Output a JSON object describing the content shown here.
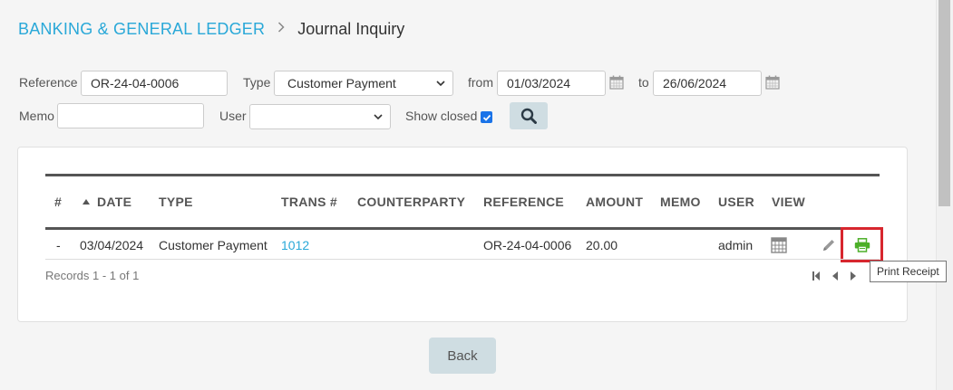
{
  "breadcrumb": {
    "parent": "BANKING & GENERAL LEDGER",
    "separator": ">",
    "current": "Journal Inquiry"
  },
  "filters": {
    "reference_label": "Reference",
    "reference_value": "OR-24-04-0006",
    "type_label": "Type",
    "type_value": "Customer Payment",
    "from_label": "from",
    "from_value": "01/03/2024",
    "to_label": "to",
    "to_value": "26/06/2024",
    "memo_label": "Memo",
    "memo_value": "",
    "user_label": "User",
    "user_value": "",
    "show_closed_label": "Show closed",
    "show_closed_checked": true
  },
  "table": {
    "columns": [
      "#",
      "DATE",
      "TYPE",
      "TRANS #",
      "COUNTERPARTY",
      "REFERENCE",
      "AMOUNT",
      "MEMO",
      "USER",
      "VIEW"
    ],
    "rows": [
      {
        "num": "-",
        "date": "03/04/2024",
        "type": "Customer Payment",
        "trans": "1012",
        "counterparty": "",
        "reference": "OR-24-04-0006",
        "amount": "20.00",
        "memo": "",
        "user": "admin"
      }
    ],
    "records_text": "Records 1 - 1 of 1"
  },
  "tooltip": {
    "text": "Print Receipt"
  },
  "actions": {
    "back_label": "Back"
  },
  "icons": {
    "search": "search-icon",
    "calendar": "calendar-icon",
    "view": "calculator-icon",
    "edit": "pencil-icon",
    "print": "printer-icon"
  },
  "colors": {
    "accent": "#29a8d8",
    "print_green": "#4caf28",
    "highlight_red": "#d7262e",
    "button_bg": "#cfdde2"
  }
}
